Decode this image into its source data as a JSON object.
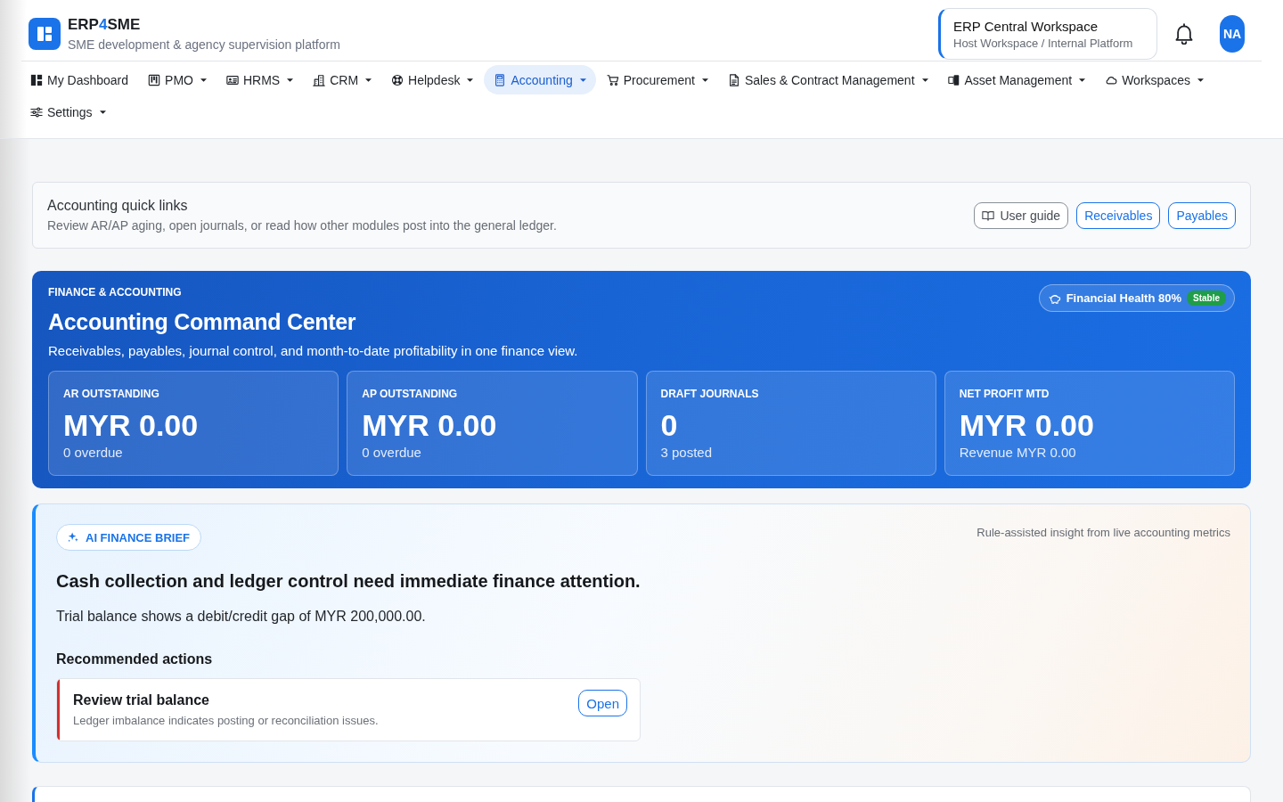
{
  "header": {
    "brand": {
      "name_start": "ERP",
      "name_accent": "4",
      "name_end": "SME",
      "tagline": "SME development & agency supervision platform"
    },
    "workspace": {
      "name": "ERP Central Workspace",
      "context": "Host Workspace / Internal Platform"
    },
    "avatar": {
      "initials": "NA"
    }
  },
  "nav": {
    "items": [
      {
        "label": "My Dashboard",
        "has_menu": false,
        "selected": false
      },
      {
        "label": "PMO",
        "has_menu": true,
        "selected": false
      },
      {
        "label": "HRMS",
        "has_menu": true,
        "selected": false
      },
      {
        "label": "CRM",
        "has_menu": true,
        "selected": false
      },
      {
        "label": "Helpdesk",
        "has_menu": true,
        "selected": false
      },
      {
        "label": "Accounting",
        "has_menu": true,
        "selected": true
      },
      {
        "label": "Procurement",
        "has_menu": true,
        "selected": false
      },
      {
        "label": "Sales & Contract Management",
        "has_menu": true,
        "selected": false
      },
      {
        "label": "Asset Management",
        "has_menu": true,
        "selected": false
      },
      {
        "label": "Workspaces",
        "has_menu": true,
        "selected": false
      },
      {
        "label": "Settings",
        "has_menu": true,
        "selected": false
      }
    ]
  },
  "quick_links": {
    "title": "Accounting quick links",
    "description": "Review AR/AP aging, open journals, or read how other modules post into the general ledger.",
    "buttons": [
      {
        "label": "User guide",
        "kind": "guide"
      },
      {
        "label": "Receivables",
        "kind": "link"
      },
      {
        "label": "Payables",
        "kind": "link"
      }
    ]
  },
  "hero": {
    "eyebrow": "FINANCE & ACCOUNTING",
    "title": "Accounting Command Center",
    "subtitle": "Receivables, payables, journal control, and month-to-date profitability in one finance view.",
    "health": {
      "label": "Financial Health 80%",
      "status": "Stable"
    },
    "stats": [
      {
        "label": "AR OUTSTANDING",
        "value": "MYR 0.00",
        "detail": "0 overdue"
      },
      {
        "label": "AP OUTSTANDING",
        "value": "MYR 0.00",
        "detail": "0 overdue"
      },
      {
        "label": "DRAFT JOURNALS",
        "value": "0",
        "detail": "3 posted"
      },
      {
        "label": "NET PROFIT MTD",
        "value": "MYR 0.00",
        "detail": "Revenue MYR 0.00"
      }
    ]
  },
  "ai_brief": {
    "badge": "AI FINANCE BRIEF",
    "note": "Rule-assisted insight from live accounting metrics",
    "headline": "Cash collection and ledger control need immediate finance attention.",
    "summary": "Trial balance shows a debit/credit gap of MYR 200,000.00.",
    "actions_title": "Recommended actions",
    "actions": [
      {
        "title": "Review trial balance",
        "description": "Ledger imbalance indicates posting or reconciliation issues.",
        "button": "Open",
        "color": "#d32f2f"
      }
    ]
  }
}
